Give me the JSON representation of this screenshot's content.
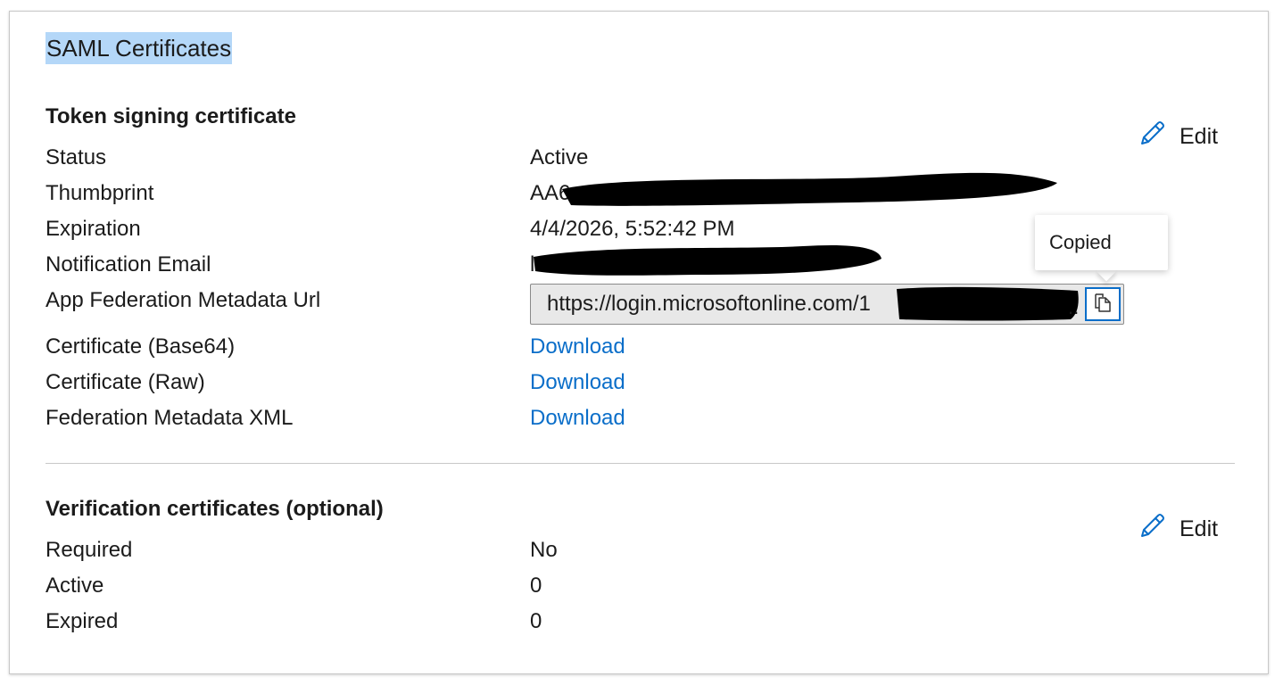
{
  "page": {
    "title": "SAML Certificates"
  },
  "token_section": {
    "title": "Token signing certificate",
    "edit_label": "Edit",
    "rows": {
      "status": {
        "label": "Status",
        "value": "Active"
      },
      "thumbprint": {
        "label": "Thumbprint",
        "value": "AA6"
      },
      "expiration": {
        "label": "Expiration",
        "value": "4/4/2026, 5:52:42 PM"
      },
      "notification_email": {
        "label": "Notification Email",
        "value": "l"
      },
      "metadata_url": {
        "label": "App Federation Metadata Url",
        "value": "https://login.microsoftonline.com/1"
      },
      "cert_base64": {
        "label": "Certificate (Base64)",
        "value": "Download"
      },
      "cert_raw": {
        "label": "Certificate (Raw)",
        "value": "Download"
      },
      "federation_xml": {
        "label": "Federation Metadata XML",
        "value": "Download"
      }
    },
    "tooltip": "Copied"
  },
  "verification_section": {
    "title": "Verification certificates (optional)",
    "edit_label": "Edit",
    "rows": {
      "required": {
        "label": "Required",
        "value": "No"
      },
      "active": {
        "label": "Active",
        "value": "0"
      },
      "expired": {
        "label": "Expired",
        "value": "0"
      }
    }
  },
  "icons": {
    "edit": "pencil-icon",
    "copy": "copy-icon"
  },
  "colors": {
    "link": "#0a6ec9",
    "title_highlight": "#b4d7f8",
    "redaction": "#000000"
  }
}
